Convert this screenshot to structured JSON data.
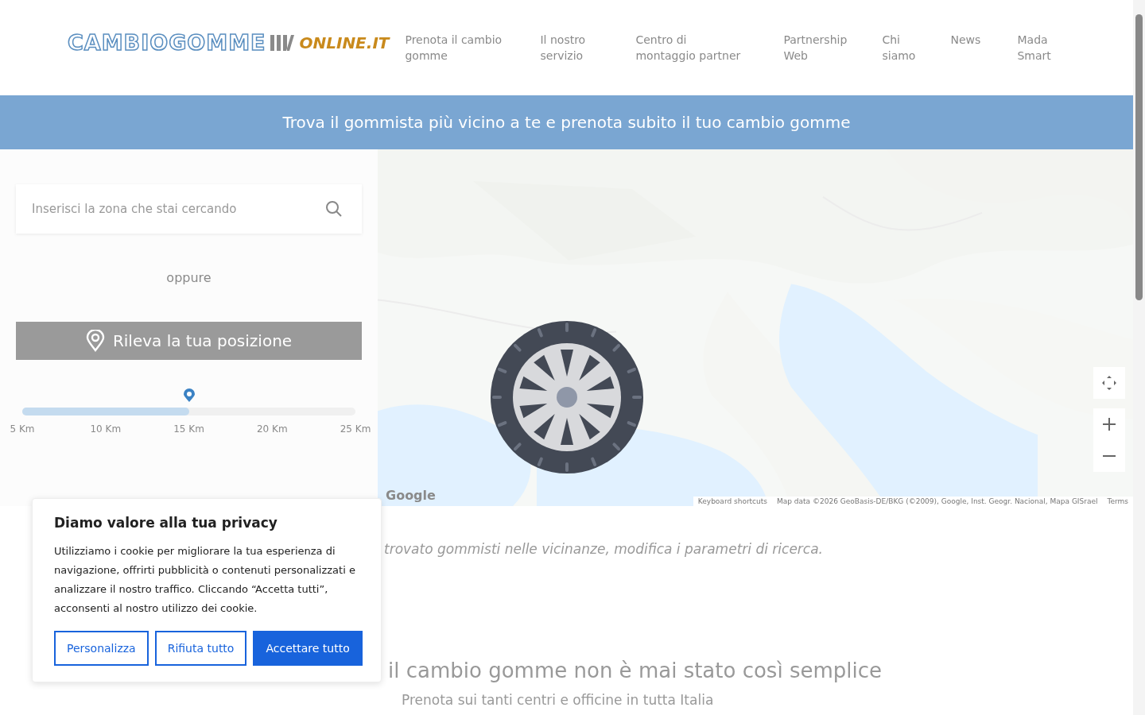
{
  "header": {
    "logo": {
      "main": "CAMBIOGOMME",
      "suffix": "ONLINE.IT"
    },
    "nav": [
      "Prenota il cambio gomme",
      "Il nostro servizio",
      "Centro di montaggio partner",
      "Partnership Web",
      "Chi siamo",
      "News",
      "Mada Smart"
    ]
  },
  "banner": {
    "text": "Trova il gommista più vicino a te e prenota subito il tuo cambio gomme"
  },
  "search": {
    "placeholder": "Inserisci la zona che stai cercando",
    "or_text": "oppure",
    "locate_button": "Rileva la tua posizione"
  },
  "radius": {
    "level": 0.5,
    "ticks": [
      "5 Km",
      "10 Km",
      "15 Km",
      "20 Km",
      "25 Km"
    ]
  },
  "map": {
    "kind": "picture",
    "google": "Google",
    "shortcuts": "Keyboard shortcuts",
    "attribution": "Map data ©2026 GeoBasis-DE/BKG (©2009), Google, Inst. Geogr. Nacional, Mapa GISrael",
    "terms": "Terms"
  },
  "results_message": "trovato gommisti nelle vicinanze, modifica i parametri di ricerca.",
  "section": {
    "title": "il cambio gomme non è mai stato così semplice",
    "subtitle": "Prenota sui tanti centri e officine in tutta Italia"
  },
  "cookie_dialog": {
    "title": "Diamo valore alla tua privacy",
    "text": "Utilizziamo i cookie per migliorare la tua esperienza di navigazione, offrirti pubblicità o contenuti personalizzati e analizzare il nostro traffico. Cliccando “Accetta tutti”, acconsenti al nostro utilizzo dei cookie.",
    "buttons": [
      {
        "label": "Personalizza",
        "kind": "outline"
      },
      {
        "label": "Rifiuta tutto",
        "kind": "outline"
      },
      {
        "label": "Accettare tutto",
        "kind": "primary"
      }
    ]
  }
}
